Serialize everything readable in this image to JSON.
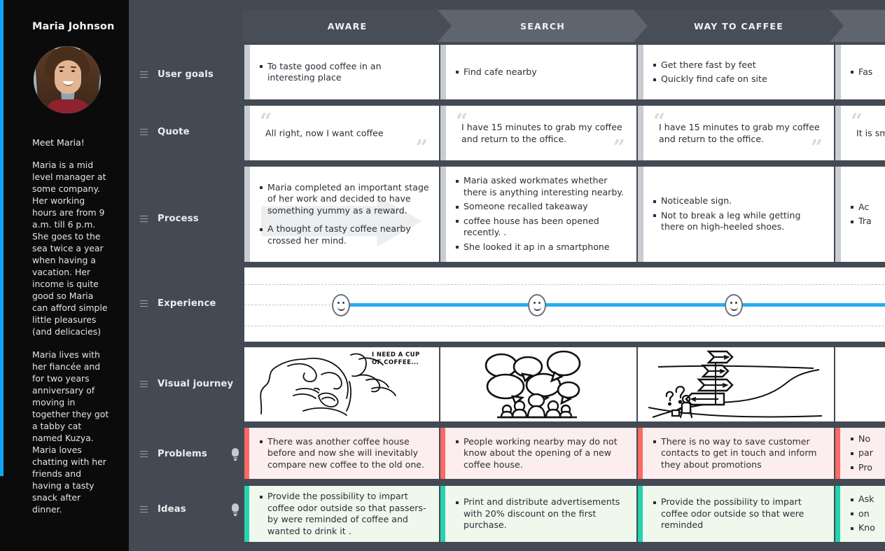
{
  "persona": {
    "name": "Maria Johnson",
    "avatar_icon": "persona-photo",
    "intro": "Meet Maria!",
    "bio_paragraphs": [
      "Maria is a mid level manager at some company. Her working hours are from 9 a.m. till 6 p.m. She goes to the sea twice a year when having a vacation. Her income is quite good so Maria can afford simple little pleasures (and delicacies)",
      "Maria lives with her fiancée and for two years anniversary of moving in together they got a tabby cat named Kuzya. Maria loves chatting with her friends and having a tasty snack after dinner."
    ]
  },
  "colors": {
    "background": "#434a54",
    "sidebar": "#0b0b0b",
    "accent_blue": "#11a3f0",
    "experience_line": "#29abf2",
    "problem_accent": "#fb6a64",
    "problem_bg": "#fceeee",
    "idea_accent": "#25d3ae",
    "idea_bg": "#eef8ec",
    "card_accent": "#c9ccd1",
    "phase_dark": "#474e58",
    "phase_light": "#5e656f"
  },
  "phases": [
    {
      "label": "AWARE",
      "tone": "dark"
    },
    {
      "label": "SEARCH",
      "tone": "light"
    },
    {
      "label": "WAY TO CAFFEE",
      "tone": "dark"
    },
    {
      "label": "",
      "tone": "light"
    }
  ],
  "rows": [
    {
      "key": "user_goals",
      "label": "User goals",
      "icon": "drag-handle-icon",
      "bulb": false
    },
    {
      "key": "quote",
      "label": "Quote",
      "icon": "drag-handle-icon",
      "bulb": false
    },
    {
      "key": "process",
      "label": "Process",
      "icon": "drag-handle-icon",
      "bulb": false
    },
    {
      "key": "experience",
      "label": "Experience",
      "icon": "drag-handle-icon",
      "bulb": false
    },
    {
      "key": "visual_journey",
      "label": "Visual journey",
      "icon": "drag-handle-icon",
      "bulb": false
    },
    {
      "key": "problems",
      "label": "Problems",
      "icon": "drag-handle-icon",
      "bulb": true
    },
    {
      "key": "ideas",
      "label": "Ideas",
      "icon": "drag-handle-icon",
      "bulb": true
    }
  ],
  "user_goals": [
    {
      "bullets": [
        "To taste good coffee in an interesting place"
      ]
    },
    {
      "bullets": [
        "Find cafe nearby"
      ]
    },
    {
      "bullets": [
        "Get there fast by feet",
        "Quickly find cafe on site"
      ]
    },
    {
      "bullets": [
        "Fas"
      ]
    }
  ],
  "quotes": [
    {
      "text": "All right, now I want coffee",
      "open": "“",
      "close": "”"
    },
    {
      "text": "I have 15 minutes to grab my coffee and return to the office.",
      "open": "“",
      "close": "”"
    },
    {
      "text": "I have 15 minutes to grab my coffee and return to the office.",
      "open": "“",
      "close": "”"
    },
    {
      "text": "It is sm",
      "open": "“",
      "close": "”"
    }
  ],
  "process": [
    {
      "bullets": [
        "Maria completed an important stage of her work and decided to have something yummy as a reward.",
        "A thought of tasty coffee nearby crossed her mind."
      ],
      "arrow": true
    },
    {
      "bullets": [
        "Maria asked workmates whether there is anything interesting nearby.",
        "Someone recalled takeaway",
        "coffee house has been opened recently. .",
        "She looked it ap in a smartphone"
      ],
      "arrow": false
    },
    {
      "bullets": [
        "Noticeable sign.",
        "Not to break a leg while getting there on high-heeled shoes."
      ],
      "arrow": false
    },
    {
      "bullets": [
        "Ac",
        "Tra"
      ],
      "arrow": false
    }
  ],
  "experience": {
    "gridlines": 3,
    "points": [
      {
        "phase": "AWARE",
        "mood": "neutral-smile",
        "level": "middle"
      },
      {
        "phase": "SEARCH",
        "mood": "neutral-smile",
        "level": "middle"
      },
      {
        "phase": "WAY TO CAFFEE",
        "mood": "neutral-smile",
        "level": "middle"
      }
    ]
  },
  "visual_journey": [
    {
      "caption": "I NEED A CUP OF COFFEE...",
      "alt": "woman-sleeping-sketch"
    },
    {
      "caption": "",
      "alt": "speech-bubbles-crowd-sketch"
    },
    {
      "caption": "",
      "alt": "signpost-road-sketch"
    },
    {
      "caption": "",
      "alt": "coffee-cup-sketch"
    }
  ],
  "problems": [
    {
      "bullets": [
        "There was another coffee house before and now she will inevitably compare new coffee to the old one."
      ]
    },
    {
      "bullets": [
        "People working nearby may do not know about the opening of a new coffee house."
      ]
    },
    {
      "bullets": [
        "There is no way to save customer contacts to get in touch and inform they about promotions"
      ]
    },
    {
      "bullets": [
        "No",
        "par",
        "Pro"
      ]
    }
  ],
  "ideas": [
    {
      "bullets": [
        "Provide the possibility to impart coffee odor outside so that passers-by were reminded of coffee and wanted to drink it ."
      ]
    },
    {
      "bullets": [
        "Print and distribute advertisements with 20% discount on the first purchase."
      ]
    },
    {
      "bullets": [
        "Provide the possibility to impart coffee odor outside so that were reminded"
      ]
    },
    {
      "bullets": [
        "Ask",
        "on",
        "Kno"
      ]
    }
  ]
}
